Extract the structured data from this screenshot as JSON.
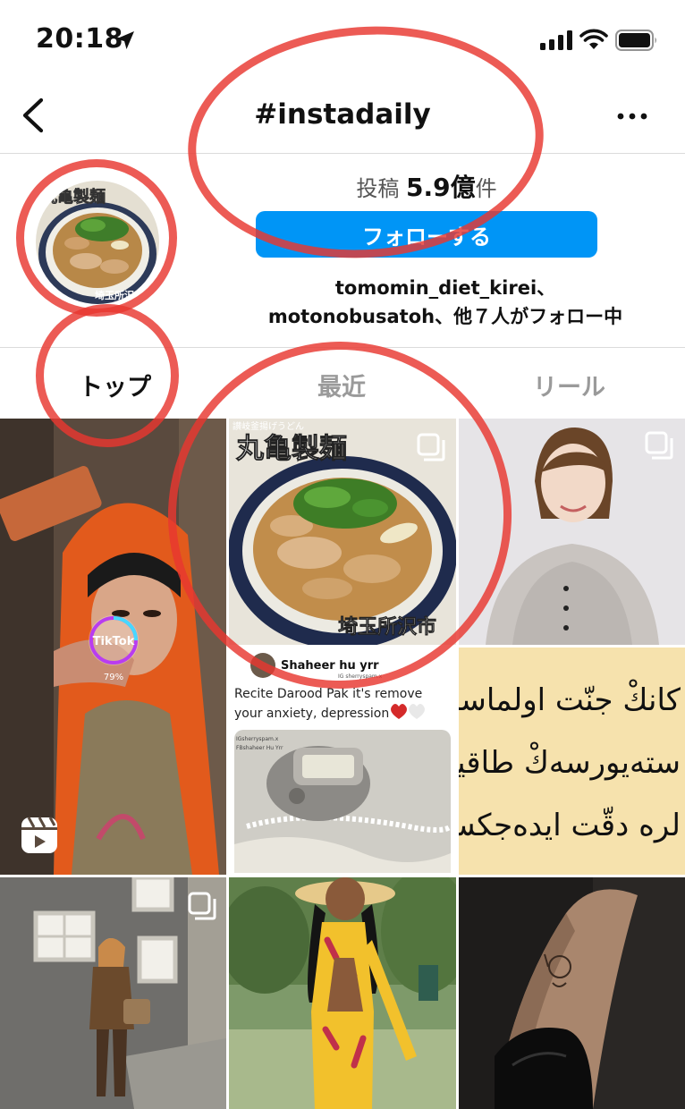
{
  "status": {
    "time": "20:18"
  },
  "header": {
    "title": "#instadaily"
  },
  "profile": {
    "posts_prefix": "投稿",
    "posts_count": "5.9",
    "posts_unit": "億",
    "posts_suffix": "件",
    "follow_label": "フォローする",
    "followers_line1": "tomomin_diet_kirei、",
    "followers_line2": "motonobusatoh、他７人がフォロー中",
    "avatar_title": "丸亀製麺",
    "avatar_caption": "埼玉所沢"
  },
  "tabs": [
    {
      "label": "トップ",
      "active": true
    },
    {
      "label": "最近",
      "active": false
    },
    {
      "label": "リール",
      "active": false
    }
  ],
  "grid": {
    "tiktok_label": "TikTok",
    "tiktok_percent": "79%",
    "food_top": "讃岐釜揚げうどん",
    "food_title": "丸亀製麺",
    "food_caption": "埼玉所沢市",
    "post_user": "Shaheer hu yrr",
    "post_handle": "IG sherryspam.x",
    "post_text_line1": "Recite Darood Pak it's remove",
    "post_text_line2": "your anxiety, depression",
    "counter_tag1": "IGsherryspam.x",
    "counter_tag2": "FBshaheer Hu Yrr",
    "arabic_line1": "كانكْ جنّت اولماسا",
    "arabic_line2": "ستەيورسەكْ طاقيلد",
    "arabic_line3": "لره دقّت ايدەجكسن"
  },
  "colors": {
    "accent": "#0095f6",
    "annotation": "#e83730",
    "inactive_tab": "#9a9a9a",
    "divider": "#dbdbdb"
  },
  "icons": {
    "back": "chevron-left-icon",
    "more": "ellipsis-icon",
    "multi": "multiple-posts-icon",
    "reel": "reels-icon"
  }
}
